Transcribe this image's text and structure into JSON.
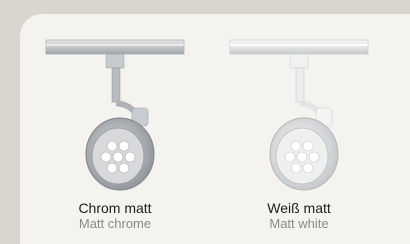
{
  "products": [
    {
      "name_de": "Chrom matt",
      "name_en": "Matt chrome",
      "finish_color": "#b9bcc0",
      "icon": "track-spotlight-chrome-icon"
    },
    {
      "name_de": "Weiß matt",
      "name_en": "Matt white",
      "finish_color": "#eceeee",
      "icon": "track-spotlight-white-icon"
    }
  ]
}
